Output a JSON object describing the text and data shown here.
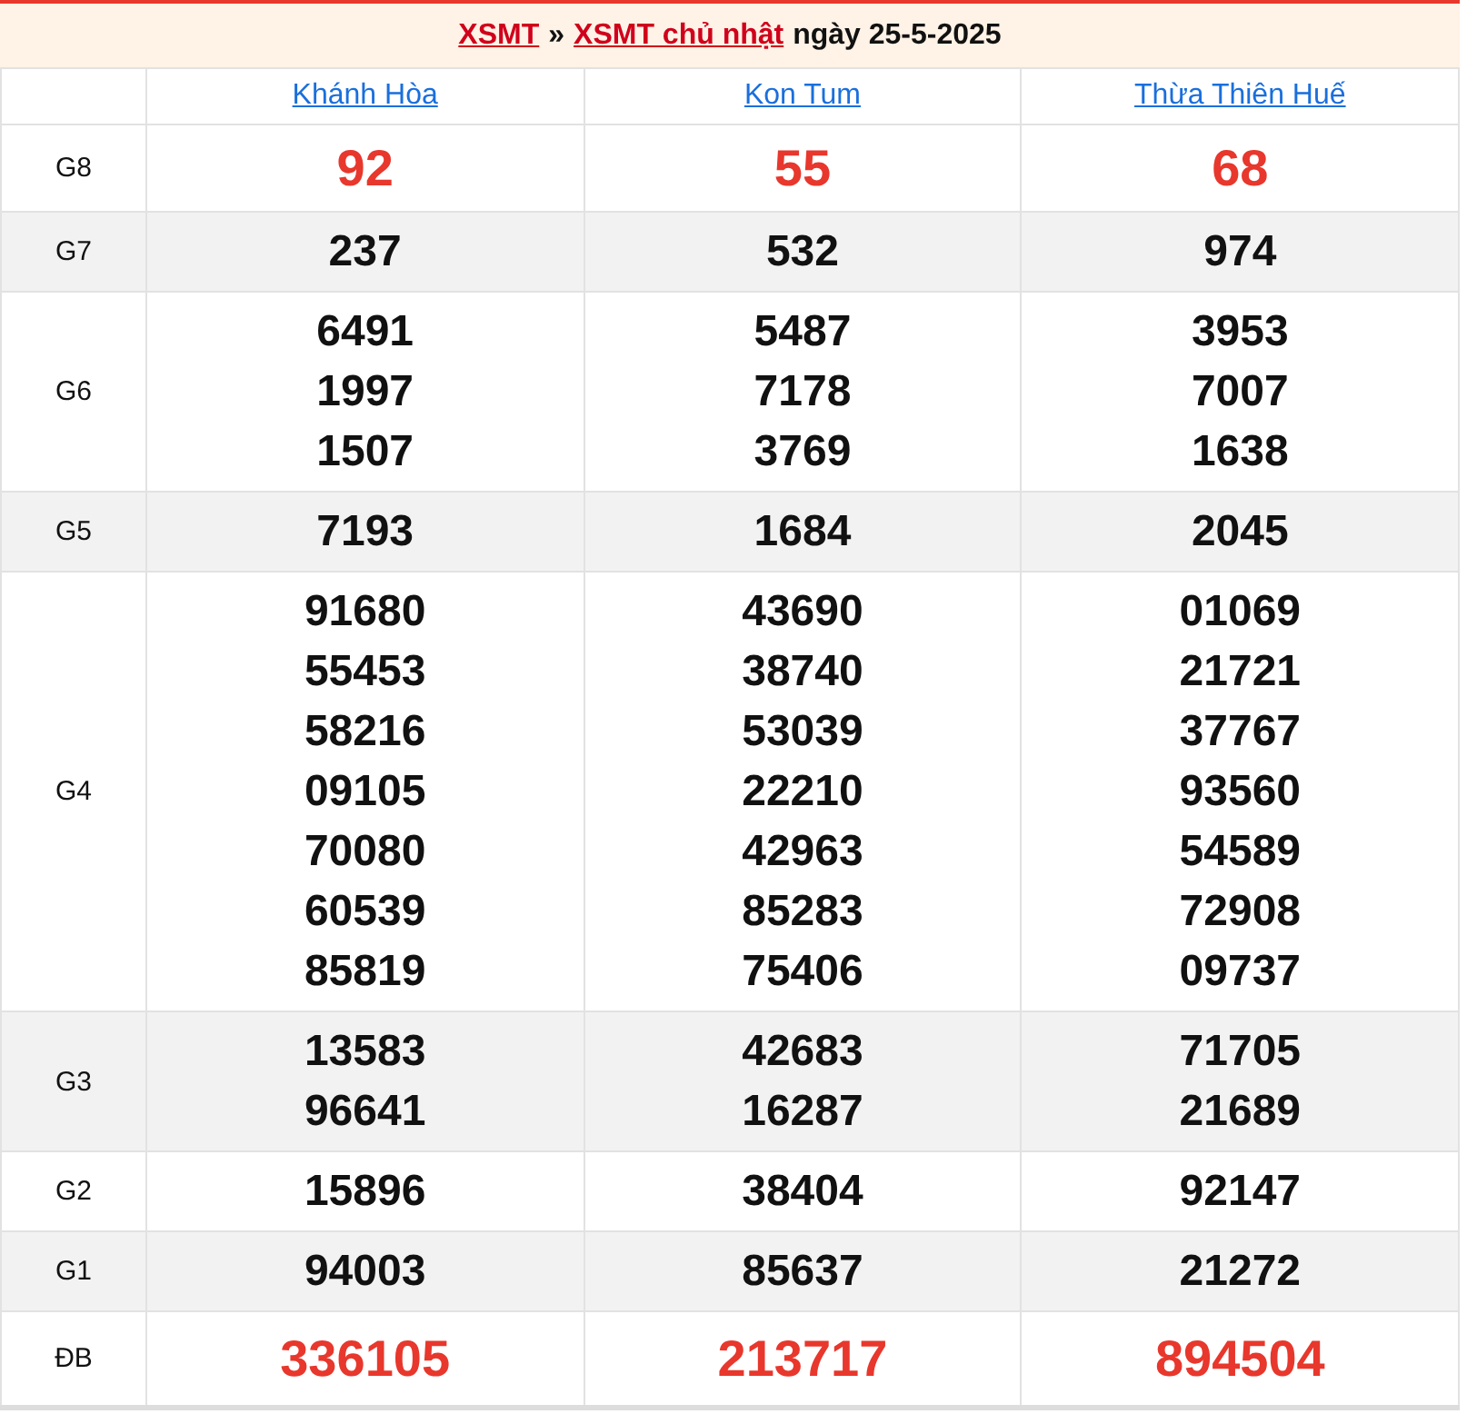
{
  "title": {
    "links": [
      "XSMT",
      "XSMT chủ nhật"
    ],
    "separator": "»",
    "date": "ngày 25-5-2025"
  },
  "provinces": [
    "Khánh Hòa",
    "Kon Tum",
    "Thừa Thiên Huế"
  ],
  "prizes": [
    {
      "label": "G8",
      "kind": "highlight",
      "results": [
        [
          "92"
        ],
        [
          "55"
        ],
        [
          "68"
        ]
      ]
    },
    {
      "label": "G7",
      "kind": "normal",
      "results": [
        [
          "237"
        ],
        [
          "532"
        ],
        [
          "974"
        ]
      ]
    },
    {
      "label": "G6",
      "kind": "normal",
      "results": [
        [
          "6491",
          "1997",
          "1507"
        ],
        [
          "5487",
          "7178",
          "3769"
        ],
        [
          "3953",
          "7007",
          "1638"
        ]
      ]
    },
    {
      "label": "G5",
      "kind": "normal",
      "results": [
        [
          "7193"
        ],
        [
          "1684"
        ],
        [
          "2045"
        ]
      ]
    },
    {
      "label": "G4",
      "kind": "normal",
      "results": [
        [
          "91680",
          "55453",
          "58216",
          "09105",
          "70080",
          "60539",
          "85819"
        ],
        [
          "43690",
          "38740",
          "53039",
          "22210",
          "42963",
          "85283",
          "75406"
        ],
        [
          "01069",
          "21721",
          "37767",
          "93560",
          "54589",
          "72908",
          "09737"
        ]
      ]
    },
    {
      "label": "G3",
      "kind": "normal",
      "results": [
        [
          "13583",
          "96641"
        ],
        [
          "42683",
          "16287"
        ],
        [
          "71705",
          "21689"
        ]
      ]
    },
    {
      "label": "G2",
      "kind": "normal",
      "results": [
        [
          "15896"
        ],
        [
          "38404"
        ],
        [
          "92147"
        ]
      ]
    },
    {
      "label": "G1",
      "kind": "normal",
      "results": [
        [
          "94003"
        ],
        [
          "85637"
        ],
        [
          "21272"
        ]
      ]
    },
    {
      "label": "ĐB",
      "kind": "jackpot",
      "results": [
        [
          "336105"
        ],
        [
          "213717"
        ],
        [
          "894504"
        ]
      ]
    }
  ]
}
